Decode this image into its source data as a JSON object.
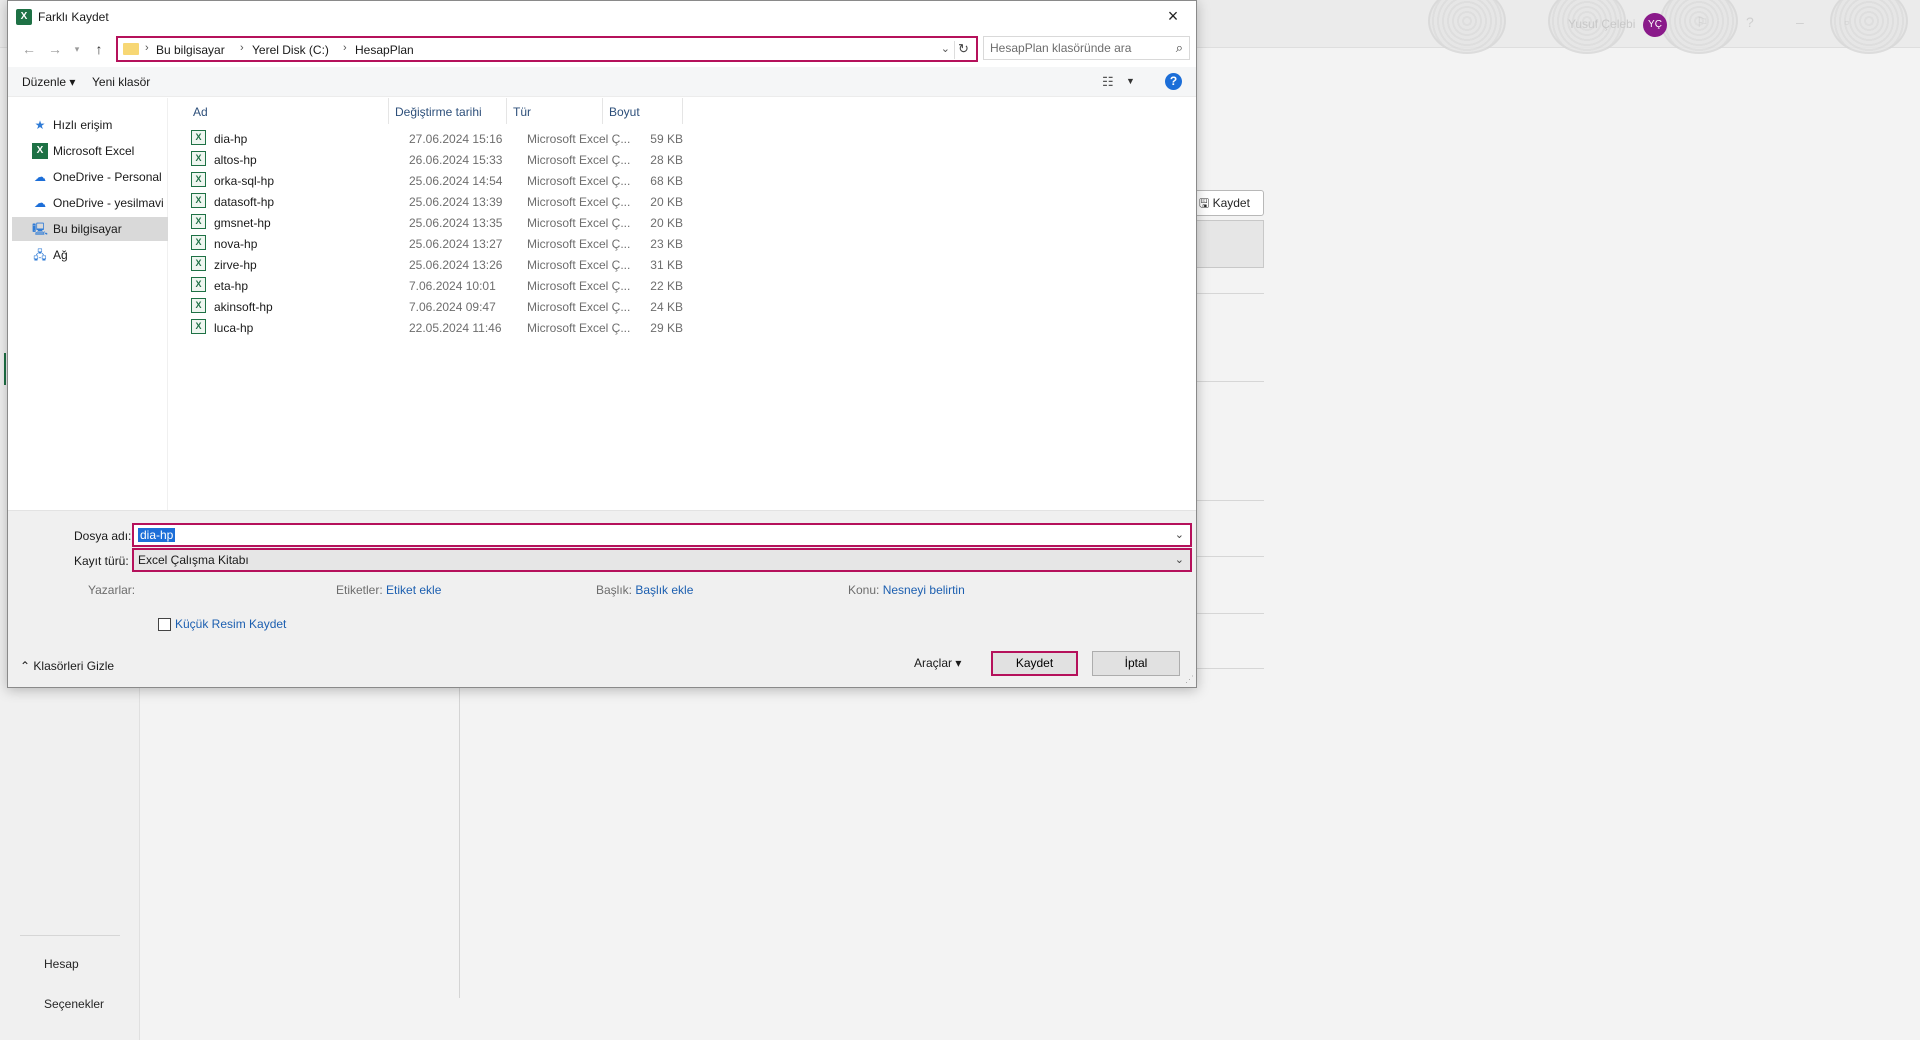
{
  "background": {
    "user_name": "Yusuf Çelebi",
    "avatar_initials": "YÇ",
    "left_nav": [
      "Hesap",
      "Seçenekler"
    ],
    "save_button": "Kaydet"
  },
  "dialog": {
    "title": "Farklı Kaydet",
    "close_icon": "×",
    "address": {
      "breadcrumbs": [
        "Bu bilgisayar",
        "Yerel Disk (C:)",
        "HesapPlan"
      ]
    },
    "search": {
      "placeholder": "HesapPlan klasöründe ara"
    },
    "toolbar": {
      "organize": "Düzenle ▾",
      "new_folder": "Yeni klasör",
      "help": "?"
    },
    "nav_items": [
      {
        "label": "Hızlı erişim",
        "icon": "star-icon"
      },
      {
        "label": "Microsoft Excel",
        "icon": "excel-icon"
      },
      {
        "label": "OneDrive - Personal",
        "icon": "onedrive-error-icon"
      },
      {
        "label": "OneDrive - yesilmavi",
        "icon": "onedrive-icon"
      },
      {
        "label": "Bu bilgisayar",
        "icon": "computer-icon",
        "selected": true
      },
      {
        "label": "Ağ",
        "icon": "network-icon"
      }
    ],
    "columns": [
      "Ad",
      "Değiştirme tarihi",
      "Tür",
      "Boyut"
    ],
    "files": [
      {
        "name": "dia-hp",
        "date": "27.06.2024 15:16",
        "type": "Microsoft Excel Ç...",
        "size": "59 KB"
      },
      {
        "name": "altos-hp",
        "date": "26.06.2024 15:33",
        "type": "Microsoft Excel Ç...",
        "size": "28 KB"
      },
      {
        "name": "orka-sql-hp",
        "date": "25.06.2024 14:54",
        "type": "Microsoft Excel Ç...",
        "size": "68 KB"
      },
      {
        "name": "datasoft-hp",
        "date": "25.06.2024 13:39",
        "type": "Microsoft Excel Ç...",
        "size": "20 KB"
      },
      {
        "name": "gmsnet-hp",
        "date": "25.06.2024 13:35",
        "type": "Microsoft Excel Ç...",
        "size": "20 KB"
      },
      {
        "name": "nova-hp",
        "date": "25.06.2024 13:27",
        "type": "Microsoft Excel Ç...",
        "size": "23 KB"
      },
      {
        "name": "zirve-hp",
        "date": "25.06.2024 13:26",
        "type": "Microsoft Excel Ç...",
        "size": "31 KB"
      },
      {
        "name": "eta-hp",
        "date": "7.06.2024 10:01",
        "type": "Microsoft Excel Ç...",
        "size": "22 KB"
      },
      {
        "name": "akinsoft-hp",
        "date": "7.06.2024 09:47",
        "type": "Microsoft Excel Ç...",
        "size": "24 KB"
      },
      {
        "name": "luca-hp",
        "date": "22.05.2024 11:46",
        "type": "Microsoft Excel Ç...",
        "size": "29 KB"
      }
    ],
    "file_name": {
      "label": "Dosya adı:",
      "value": "dia-hp"
    },
    "save_type": {
      "label": "Kayıt türü:",
      "value": "Excel Çalışma Kitabı"
    },
    "meta": {
      "authors_label": "Yazarlar:",
      "tags_label": "Etiketler:",
      "tags_value": "Etiket ekle",
      "title_label": "Başlık:",
      "title_value": "Başlık ekle",
      "subject_label": "Konu:",
      "subject_value": "Nesneyi belirtin"
    },
    "thumbnail_label": "Küçük Resim Kaydet",
    "hide_folders": "Klasörleri Gizle",
    "tools": "Araçlar ▾",
    "save": "Kaydet",
    "cancel": "İptal"
  }
}
